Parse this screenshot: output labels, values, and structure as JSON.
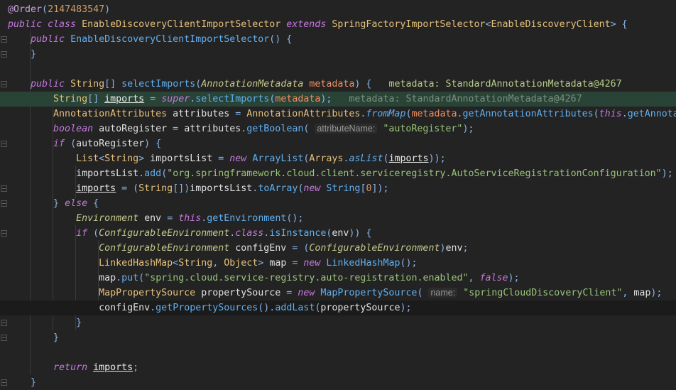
{
  "editor": {
    "theme_colors": {
      "background": "#232323",
      "execution_line": "#294436",
      "current_line": "#1b1b1b"
    },
    "lines": [
      {
        "tokens": [
          {
            "t": "@Order",
            "c": "annot"
          },
          {
            "t": "(",
            "c": "p"
          },
          {
            "t": "2147483547",
            "c": "num"
          },
          {
            "t": ")",
            "c": "p"
          }
        ]
      },
      {
        "tokens": [
          {
            "t": "public class ",
            "c": "kw"
          },
          {
            "t": "EnableDiscoveryClientImportSelector ",
            "c": "type"
          },
          {
            "t": "extends ",
            "c": "kw"
          },
          {
            "t": "SpringFactoryImportSelector",
            "c": "type"
          },
          {
            "t": "<",
            "c": "p"
          },
          {
            "t": "EnableDiscoveryClient",
            "c": "type"
          },
          {
            "t": "> {",
            "c": "p"
          }
        ]
      },
      {
        "tokens": [
          {
            "t": "    ",
            "c": "plain"
          },
          {
            "t": "public ",
            "c": "kw"
          },
          {
            "t": "EnableDiscoveryClientImportSelector",
            "c": "fn"
          },
          {
            "t": "() {",
            "c": "p"
          }
        ]
      },
      {
        "tokens": [
          {
            "t": "    ",
            "c": "plain"
          },
          {
            "t": "}",
            "c": "p"
          }
        ]
      },
      {
        "tokens": []
      },
      {
        "tokens": [
          {
            "t": "    ",
            "c": "plain"
          },
          {
            "t": "public ",
            "c": "kw"
          },
          {
            "t": "String",
            "c": "type"
          },
          {
            "t": "[] ",
            "c": "p"
          },
          {
            "t": "selectImports",
            "c": "fn"
          },
          {
            "t": "(",
            "c": "p"
          },
          {
            "t": "AnnotationMetadata ",
            "c": "itype"
          },
          {
            "t": "metadata",
            "c": "param"
          },
          {
            "t": ") {   ",
            "c": "p"
          },
          {
            "t": "metadata: StandardAnnotationMetadata@4267",
            "c": "dbg"
          }
        ]
      },
      {
        "state": "exec",
        "tokens": [
          {
            "t": "        ",
            "c": "plain"
          },
          {
            "t": "String",
            "c": "type"
          },
          {
            "t": "[] ",
            "c": "p"
          },
          {
            "t": "imports",
            "c": "ul"
          },
          {
            "t": " = ",
            "c": "p"
          },
          {
            "t": "super",
            "c": "kw"
          },
          {
            "t": ".",
            "c": "p"
          },
          {
            "t": "selectImports",
            "c": "fn"
          },
          {
            "t": "(",
            "c": "p"
          },
          {
            "t": "metadata",
            "c": "param"
          },
          {
            "t": ");   ",
            "c": "p"
          },
          {
            "t": "metadata: StandardAnnotationMetadata@4267",
            "c": "dbg2"
          }
        ]
      },
      {
        "tokens": [
          {
            "t": "        ",
            "c": "plain"
          },
          {
            "t": "AnnotationAttributes ",
            "c": "type"
          },
          {
            "t": "attributes",
            "c": "plain"
          },
          {
            "t": " = ",
            "c": "p"
          },
          {
            "t": "AnnotationAttributes",
            "c": "type"
          },
          {
            "t": ".",
            "c": "p"
          },
          {
            "t": "fromMap",
            "c": "ifn"
          },
          {
            "t": "(",
            "c": "p"
          },
          {
            "t": "metadata",
            "c": "param"
          },
          {
            "t": ".",
            "c": "p"
          },
          {
            "t": "getAnnotationAttributes",
            "c": "fn"
          },
          {
            "t": "(",
            "c": "p"
          },
          {
            "t": "this",
            "c": "kw"
          },
          {
            "t": ".",
            "c": "p"
          },
          {
            "t": "getAnnota",
            "c": "fn"
          }
        ]
      },
      {
        "tokens": [
          {
            "t": "        ",
            "c": "plain"
          },
          {
            "t": "boolean ",
            "c": "kw"
          },
          {
            "t": "autoRegister",
            "c": "plain"
          },
          {
            "t": " = ",
            "c": "p"
          },
          {
            "t": "attributes",
            "c": "plain"
          },
          {
            "t": ".",
            "c": "p"
          },
          {
            "t": "getBoolean",
            "c": "fn"
          },
          {
            "t": "( ",
            "c": "p"
          },
          {
            "t": "attributeName:",
            "c": "hint"
          },
          {
            "t": " ",
            "c": "plain"
          },
          {
            "t": "\"autoRegister\"",
            "c": "str"
          },
          {
            "t": ");",
            "c": "p"
          }
        ]
      },
      {
        "tokens": [
          {
            "t": "        ",
            "c": "plain"
          },
          {
            "t": "if ",
            "c": "kw"
          },
          {
            "t": "(",
            "c": "p"
          },
          {
            "t": "autoRegister",
            "c": "plain"
          },
          {
            "t": ") {",
            "c": "p"
          }
        ]
      },
      {
        "tokens": [
          {
            "t": "            ",
            "c": "plain"
          },
          {
            "t": "List",
            "c": "type"
          },
          {
            "t": "<",
            "c": "p"
          },
          {
            "t": "String",
            "c": "type"
          },
          {
            "t": "> ",
            "c": "p"
          },
          {
            "t": "importsList",
            "c": "plain"
          },
          {
            "t": " = ",
            "c": "p"
          },
          {
            "t": "new ",
            "c": "kw"
          },
          {
            "t": "ArrayList",
            "c": "fn"
          },
          {
            "t": "(",
            "c": "p"
          },
          {
            "t": "Arrays",
            "c": "type"
          },
          {
            "t": ".",
            "c": "p"
          },
          {
            "t": "asList",
            "c": "ifn"
          },
          {
            "t": "(",
            "c": "p"
          },
          {
            "t": "imports",
            "c": "ul"
          },
          {
            "t": "));",
            "c": "p"
          }
        ]
      },
      {
        "tokens": [
          {
            "t": "            ",
            "c": "plain"
          },
          {
            "t": "importsList",
            "c": "plain"
          },
          {
            "t": ".",
            "c": "p"
          },
          {
            "t": "add",
            "c": "fn"
          },
          {
            "t": "(",
            "c": "p"
          },
          {
            "t": "\"org.springframework.cloud.client.serviceregistry.AutoServiceRegistrationConfiguration\"",
            "c": "str"
          },
          {
            "t": ");",
            "c": "p"
          }
        ]
      },
      {
        "tokens": [
          {
            "t": "            ",
            "c": "plain"
          },
          {
            "t": "imports",
            "c": "ul"
          },
          {
            "t": " = (",
            "c": "p"
          },
          {
            "t": "String",
            "c": "type"
          },
          {
            "t": "[])",
            "c": "p"
          },
          {
            "t": "importsList",
            "c": "plain"
          },
          {
            "t": ".",
            "c": "p"
          },
          {
            "t": "toArray",
            "c": "fn"
          },
          {
            "t": "(",
            "c": "p"
          },
          {
            "t": "new ",
            "c": "kw"
          },
          {
            "t": "String",
            "c": "fn"
          },
          {
            "t": "[",
            "c": "p"
          },
          {
            "t": "0",
            "c": "num"
          },
          {
            "t": "]);",
            "c": "p"
          }
        ]
      },
      {
        "tokens": [
          {
            "t": "        ",
            "c": "plain"
          },
          {
            "t": "} ",
            "c": "p"
          },
          {
            "t": "else ",
            "c": "kw"
          },
          {
            "t": "{",
            "c": "p"
          }
        ]
      },
      {
        "tokens": [
          {
            "t": "            ",
            "c": "plain"
          },
          {
            "t": "Environment ",
            "c": "itype"
          },
          {
            "t": "env",
            "c": "plain"
          },
          {
            "t": " = ",
            "c": "p"
          },
          {
            "t": "this",
            "c": "kw"
          },
          {
            "t": ".",
            "c": "p"
          },
          {
            "t": "getEnvironment",
            "c": "fn"
          },
          {
            "t": "();",
            "c": "p"
          }
        ]
      },
      {
        "tokens": [
          {
            "t": "            ",
            "c": "plain"
          },
          {
            "t": "if ",
            "c": "kw"
          },
          {
            "t": "(",
            "c": "p"
          },
          {
            "t": "ConfigurableEnvironment",
            "c": "itype"
          },
          {
            "t": ".",
            "c": "p"
          },
          {
            "t": "class",
            "c": "kw"
          },
          {
            "t": ".",
            "c": "p"
          },
          {
            "t": "isInstance",
            "c": "fn"
          },
          {
            "t": "(",
            "c": "p"
          },
          {
            "t": "env",
            "c": "plain"
          },
          {
            "t": ")) {",
            "c": "p"
          }
        ]
      },
      {
        "tokens": [
          {
            "t": "                ",
            "c": "plain"
          },
          {
            "t": "ConfigurableEnvironment ",
            "c": "itype"
          },
          {
            "t": "configEnv",
            "c": "plain"
          },
          {
            "t": " = (",
            "c": "p"
          },
          {
            "t": "ConfigurableEnvironment",
            "c": "itype"
          },
          {
            "t": ")",
            "c": "p"
          },
          {
            "t": "env",
            "c": "plain"
          },
          {
            "t": ";",
            "c": "p"
          }
        ]
      },
      {
        "tokens": [
          {
            "t": "                ",
            "c": "plain"
          },
          {
            "t": "LinkedHashMap",
            "c": "type"
          },
          {
            "t": "<",
            "c": "p"
          },
          {
            "t": "String",
            "c": "type"
          },
          {
            "t": ", ",
            "c": "p"
          },
          {
            "t": "Object",
            "c": "type"
          },
          {
            "t": "> ",
            "c": "p"
          },
          {
            "t": "map",
            "c": "plain"
          },
          {
            "t": " = ",
            "c": "p"
          },
          {
            "t": "new ",
            "c": "kw"
          },
          {
            "t": "LinkedHashMap",
            "c": "fn"
          },
          {
            "t": "();",
            "c": "p"
          }
        ]
      },
      {
        "tokens": [
          {
            "t": "                ",
            "c": "plain"
          },
          {
            "t": "map",
            "c": "plain"
          },
          {
            "t": ".",
            "c": "p"
          },
          {
            "t": "put",
            "c": "fn"
          },
          {
            "t": "(",
            "c": "p"
          },
          {
            "t": "\"spring.cloud.service-registry.auto-registration.enabled\"",
            "c": "str"
          },
          {
            "t": ", ",
            "c": "p"
          },
          {
            "t": "false",
            "c": "kw"
          },
          {
            "t": ");",
            "c": "p"
          }
        ]
      },
      {
        "tokens": [
          {
            "t": "                ",
            "c": "plain"
          },
          {
            "t": "MapPropertySource ",
            "c": "type"
          },
          {
            "t": "propertySource",
            "c": "plain"
          },
          {
            "t": " = ",
            "c": "p"
          },
          {
            "t": "new ",
            "c": "kw"
          },
          {
            "t": "MapPropertySource",
            "c": "fn"
          },
          {
            "t": "( ",
            "c": "p"
          },
          {
            "t": "name:",
            "c": "hint"
          },
          {
            "t": " ",
            "c": "plain"
          },
          {
            "t": "\"springCloudDiscoveryClient\"",
            "c": "str"
          },
          {
            "t": ", ",
            "c": "p"
          },
          {
            "t": "map",
            "c": "plain"
          },
          {
            "t": ");",
            "c": "p"
          }
        ]
      },
      {
        "state": "current",
        "tokens": [
          {
            "t": "                ",
            "c": "plain"
          },
          {
            "t": "configEnv",
            "c": "plain"
          },
          {
            "t": ".",
            "c": "p"
          },
          {
            "t": "getPropertySources",
            "c": "fn"
          },
          {
            "t": "().",
            "c": "p"
          },
          {
            "t": "addLast",
            "c": "fn"
          },
          {
            "t": "(",
            "c": "p"
          },
          {
            "t": "propertySource",
            "c": "plain"
          },
          {
            "t": ");",
            "c": "p"
          }
        ]
      },
      {
        "tokens": [
          {
            "t": "            ",
            "c": "plain"
          },
          {
            "t": "}",
            "c": "p"
          }
        ]
      },
      {
        "tokens": [
          {
            "t": "        ",
            "c": "plain"
          },
          {
            "t": "}",
            "c": "p"
          }
        ]
      },
      {
        "tokens": []
      },
      {
        "tokens": [
          {
            "t": "        ",
            "c": "plain"
          },
          {
            "t": "return ",
            "c": "kw"
          },
          {
            "t": "imports",
            "c": "ul"
          },
          {
            "t": ";",
            "c": "p"
          }
        ]
      },
      {
        "tokens": [
          {
            "t": "    ",
            "c": "plain"
          },
          {
            "t": "}",
            "c": "p"
          }
        ]
      }
    ]
  }
}
